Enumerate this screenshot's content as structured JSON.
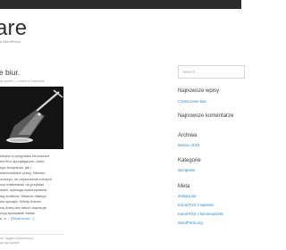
{
  "header": {
    "site_title": "are",
    "tagline": "a WordPress"
  },
  "post": {
    "title": "ie biur.",
    "meta": "by admin — Leave a Comment",
    "excerpt_lines": [
      "ektyka w przypadku biurowców",
      "ew firm sprzątających, które",
      "ego budynków, jak i",
      "stanowiskach pracy. Nikomu",
      "oraczyć, że czyszczenie różnych",
      "czy materiałów, na przykład",
      "adeń, wymaga wykorzystania",
      "ług środków. Właśnie dlatego",
      "stu sprząta. Wiedy dobrze",
      "nią firmą bez takich dopasuje.",
      "nują sprzątanie działa",
      "e, a ..."
    ],
    "read_more": "[Read more...]",
    "footer_lines": [
      "ne Tagged czyszczenie,",
      "ąw sprzątanie"
    ]
  },
  "sidebar": {
    "search_placeholder": "Search ...",
    "recent_posts_title": "Najnowsze wpisy",
    "recent_posts": [
      "Czyszczenie biur."
    ],
    "recent_comments_title": "Najnowsze komentarze",
    "archives_title": "Archiwa",
    "archives": [
      "Marzec 2015"
    ],
    "categories_title": "Kategorie",
    "categories": [
      "sprzątanie"
    ],
    "meta_title": "Meta",
    "meta_links": [
      "Zaloguj się",
      "Kanał RSS z wpisami",
      "Kanał RSS z komentarzami",
      "WordPress.org"
    ]
  },
  "colors": {
    "accent": "#2a8acd",
    "topbar": "#2c2c2c",
    "text_dark": "#3a3a3a",
    "text_muted": "#999999"
  }
}
